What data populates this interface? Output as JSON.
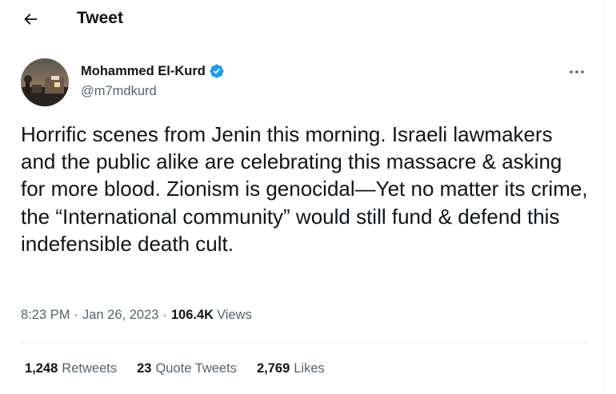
{
  "header": {
    "title": "Tweet"
  },
  "author": {
    "name": "Mohammed El-Kurd",
    "handle": "@m7mdkurd"
  },
  "tweet": {
    "text": "Horrific scenes from Jenin this morning. Israeli lawmakers and the public alike are celebrating this massacre & asking for more blood. Zionism is genocidal—Yet no matter its crime, the “International community” would still fund & defend this indefensible death cult.",
    "time": "8:23 PM",
    "date": "Jan 26, 2023",
    "separator": "·",
    "views_count": "106.4K",
    "views_label": "Views"
  },
  "stats": [
    {
      "count": "1,248",
      "label": "Retweets"
    },
    {
      "count": "23",
      "label": "Quote Tweets"
    },
    {
      "count": "2,769",
      "label": "Likes"
    }
  ],
  "icons": {
    "back": "arrow-left-icon",
    "verified": "verified-badge-icon",
    "more": "more-horizontal-icon"
  },
  "colors": {
    "text_primary": "#0f1419",
    "text_secondary": "#536471",
    "verified": "#1d9bf0",
    "divider": "#eff3f4"
  }
}
